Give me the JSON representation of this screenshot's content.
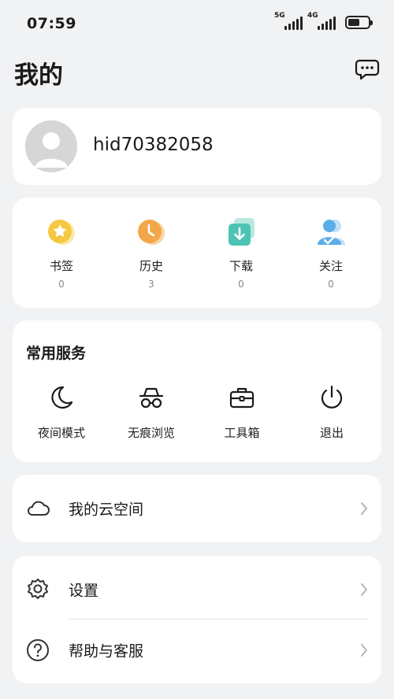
{
  "status": {
    "time": "07:59",
    "net1": "5G",
    "net2": "4G"
  },
  "header": {
    "title": "我的",
    "message_icon": "chat-bubble-icon"
  },
  "profile": {
    "username": "hid70382058",
    "avatar_icon": "default-avatar-icon"
  },
  "stats": [
    {
      "label": "书签",
      "count": "0",
      "icon": "bookmark-star-icon",
      "color": "#f5c842"
    },
    {
      "label": "历史",
      "count": "3",
      "icon": "history-clock-icon",
      "color": "#f3a64a"
    },
    {
      "label": "下载",
      "count": "0",
      "icon": "download-icon",
      "color": "#4fc3b3"
    },
    {
      "label": "关注",
      "count": "0",
      "icon": "follow-user-icon",
      "color": "#5aaee6"
    }
  ],
  "services": {
    "title": "常用服务",
    "items": [
      {
        "label": "夜间模式",
        "icon": "moon-icon"
      },
      {
        "label": "无痕浏览",
        "icon": "incognito-icon"
      },
      {
        "label": "工具箱",
        "icon": "toolbox-icon"
      },
      {
        "label": "退出",
        "icon": "power-icon"
      }
    ]
  },
  "cloud": {
    "label": "我的云空间",
    "icon": "cloud-icon"
  },
  "settings": [
    {
      "label": "设置",
      "icon": "gear-icon"
    },
    {
      "label": "帮助与客服",
      "icon": "help-circle-icon"
    }
  ]
}
